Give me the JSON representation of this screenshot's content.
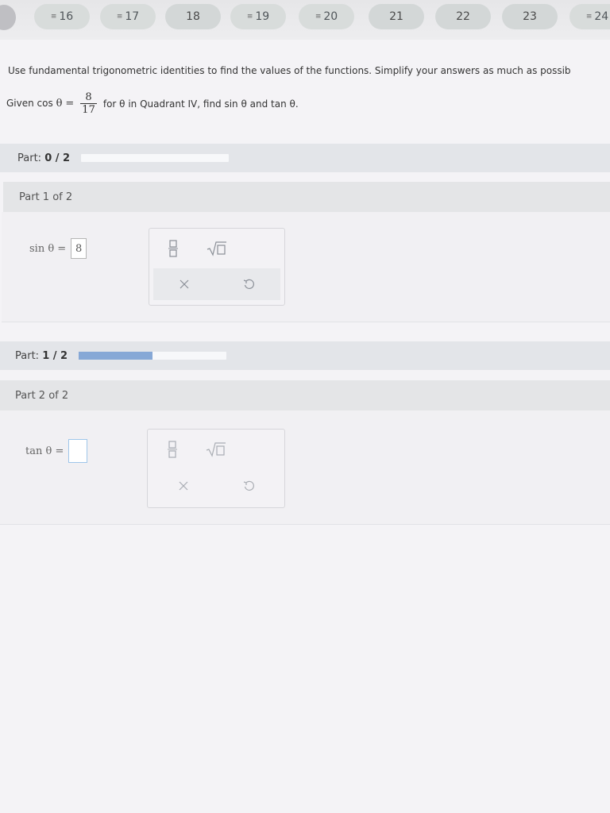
{
  "nav": {
    "questions": [
      {
        "label": "16",
        "flagged": true
      },
      {
        "label": "17",
        "flagged": true
      },
      {
        "label": "18",
        "flagged": false
      },
      {
        "label": "19",
        "flagged": true
      },
      {
        "label": "20",
        "flagged": true
      },
      {
        "label": "21",
        "flagged": false
      },
      {
        "label": "22",
        "flagged": false
      },
      {
        "label": "23",
        "flagged": false
      },
      {
        "label": "24",
        "flagged": true
      }
    ],
    "flag_glyph": "≡"
  },
  "problem": {
    "instruction": "Use fundamental trigonometric identities to find the values of the functions. Simplify your answers as much as possib",
    "given_prefix": "Given cos",
    "theta": "θ",
    "equals": "=",
    "frac_num": "8",
    "frac_den": "17",
    "given_suffix": "for θ in Quadrant IV, find sin θ and tan θ."
  },
  "part1": {
    "progress_label": "Part:",
    "progress_value": "0 / 2",
    "progress_fraction": 0.0,
    "header": "Part 1 of 2",
    "lhs": "sin θ =",
    "answer_value": "8"
  },
  "part2": {
    "progress_label": "Part:",
    "progress_value": "1 / 2",
    "progress_fraction": 0.5,
    "header": "Part 2 of 2",
    "lhs": "tan θ =",
    "answer_value": ""
  },
  "palette": {
    "fraction_icon": "fraction-icon",
    "sqrt_icon": "sqrt-icon",
    "clear_icon": "close-icon",
    "undo_icon": "undo-icon"
  }
}
